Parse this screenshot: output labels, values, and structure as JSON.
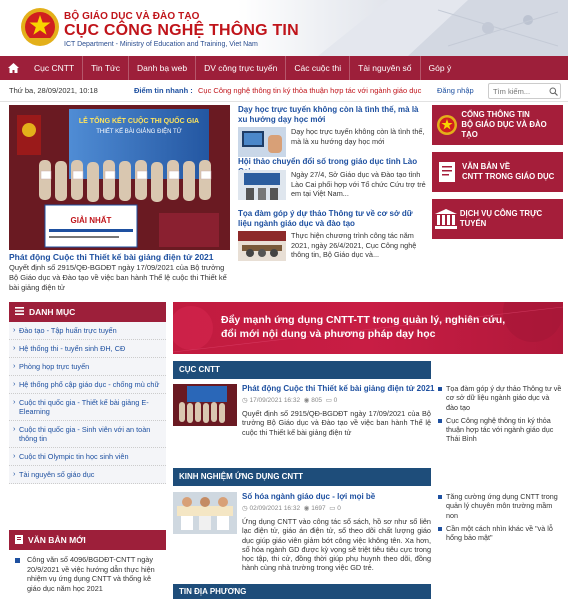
{
  "header": {
    "ministry": "BỘ GIÁO DỤC VÀ ĐÀO TẠO",
    "agency": "CỤC CÔNG NGHỆ THÔNG TIN",
    "agency_en": "ICT Department - Ministry of Education and Training, Viet Nam"
  },
  "nav": {
    "home_icon": "home-icon",
    "items": [
      "Cục CNTT",
      "Tin Tức",
      "Danh bạ web",
      "DV công trực tuyến",
      "Các cuộc thi",
      "Tài nguyên số",
      "Góp ý"
    ]
  },
  "infobar": {
    "date": "Thứ ba, 28/09/2021, 10:18",
    "ticker_label": "Điểm tin nhanh :",
    "ticker_text": "Cục Công nghệ thông tin ký thỏa thuận hợp tác với ngành giáo dục Thái...",
    "login": "Đăng nhập",
    "search_placeholder": "Tìm kiếm..."
  },
  "featured": {
    "image_text_1": "LỄ TỔNG KẾT CUỘC THI QUỐC GIA",
    "image_text_2": "THIẾT KẾ BÀI GIẢNG ĐIỆN TỬ",
    "image_text_3": "GIẢI NHẤT",
    "title": "Phát động Cuộc thi Thiết kế bài giảng điện tử 2021",
    "desc": "Quyết định số 2915/QĐ-BGDĐT ngày 17/09/2021 của Bộ trưởng Bộ Giáo dục và Đào tạo về việc ban hành Thể lệ cuộc thi Thiết kế bài giảng điện tử"
  },
  "middle_news": [
    {
      "title": "Dạy học trực tuyến không còn là tình thế, mà là xu hướng dạy học mới",
      "desc": "Dạy học trực tuyến không còn là tình thế, mà là xu hướng dạy học mới"
    },
    {
      "title": "Hội thảo chuyển đổi số trong giáo dục tỉnh Lào Cai",
      "desc": "Ngày 27/4, Sở Giáo dục và Đào tạo tỉnh Lào Cai phối hợp với Tổ chức Cứu trợ trẻ em tại Việt Nam..."
    },
    {
      "title": "Tọa đàm góp ý dự thảo Thông tư về cơ sở dữ liệu ngành giáo dục và đào tạo",
      "desc": "Thực hiện chương trình công tác năm 2021, ngày 26/4/2021, Cục Công nghệ thông tin, Bộ Giáo dục và..."
    }
  ],
  "right_banners": [
    {
      "line1": "CỔNG THÔNG TIN",
      "line2": "BỘ GIÁO DỤC VÀ ĐÀO TẠO",
      "icon": "emblem-icon"
    },
    {
      "line1": "VĂN BẢN VỀ",
      "line2": "CNTT TRONG GIÁO DỤC",
      "icon": "document-icon"
    },
    {
      "line1": "DỊCH VỤ CÔNG TRỰC TUYẾN",
      "line2": "",
      "icon": "building-icon"
    }
  ],
  "sidebar": {
    "heading": "DANH MỤC",
    "items": [
      "Đào tạo - Tập huấn trực tuyến",
      "Hệ thống thi - tuyển sinh ĐH, CĐ",
      "Phòng họp trực tuyến",
      "Hệ thống phổ cập giáo dục - chống mù chữ",
      "Cuộc thi quốc gia - Thiết kế bài giảng E-Elearning",
      "Cuộc thi quốc gia - Sinh viên với an toàn thông tin",
      "Cuộc thi Olympic tin học sinh viên",
      "Tài nguyên số giáo dục"
    ],
    "docs_heading": "VĂN BẢN MỚI",
    "docs_text": "Công văn số 4096/BGDĐT-CNTT ngày 20/9/2021 về việc hướng dẫn thực hiện nhiệm vụ ứng dụng CNTT và thống kê giáo dục năm học 2021"
  },
  "big_banner": {
    "line1": "Đẩy mạnh ứng dụng CNTT-TT trong quản lý, nghiên cứu,",
    "line2": "đổi mới nội dung và phương pháp dạy học"
  },
  "section_cntt": {
    "heading": "CỤC CNTT",
    "title": "Phát động Cuộc thi Thiết kế bài giảng điện tử 2021",
    "meta_date": "17/09/2021 16:32",
    "meta_views": "805",
    "meta_comments": "0",
    "desc": "Quyết định số 2915/QĐ-BGDĐT ngày 17/09/2021 của Bộ trưởng Bộ Giáo dục và Đào tạo về việc ban hành Thể lệ cuộc thi Thiết kế bài giảng điện tử",
    "bullets": [
      "Tọa đàm góp ý dự thảo Thông tư về cơ sở dữ liệu ngành giáo dục và đào tạo",
      "Cục Công nghệ thông tin ký thỏa thuận hợp tác với ngành giáo dục Thái Bình"
    ]
  },
  "section_kinh_nghiem": {
    "heading": "KINH NGHIỆM ỨNG DỤNG CNTT",
    "title": "Số hóa ngành giáo dục - lợi mọi bề",
    "meta_date": "02/09/2021 16:32",
    "meta_views": "1697",
    "meta_comments": "0",
    "desc": "Ứng dụng CNTT vào công tác sổ sách, hồ sơ như sổ liên lạc điện tử, giáo án điện tử, sổ theo dõi chất lượng giáo dục giúp giáo viên giảm bớt công việc không tên. Xa hơn, số hóa ngành GD được kỳ vọng sẽ triệt tiêu tiêu cực trong học tập, thi cử, đồng thời giúp phụ huynh theo dõi, đồng hành cùng nhà trường trong việc GD trẻ.",
    "bullets": [
      "Tăng cường ứng dụng CNTT trong quản lý chuyên môn trường mầm non",
      "Cần một cách nhìn khác về \"và lỗ hổng bảo mật\""
    ]
  },
  "section_dia_phuong": {
    "heading": "TIN ĐỊA PHƯƠNG"
  }
}
